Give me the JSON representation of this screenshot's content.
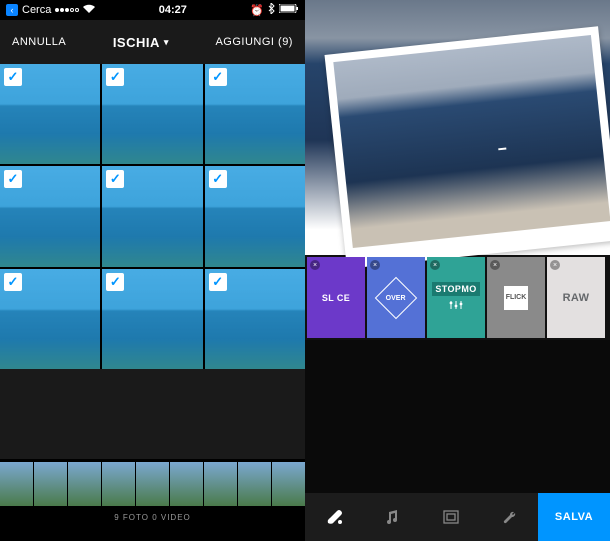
{
  "left": {
    "status": {
      "back_label": "Cerca",
      "time": "04:27",
      "signal_filled": 3,
      "signal_total": 5
    },
    "nav": {
      "cancel": "ANNULLA",
      "title": "ISCHIA",
      "add": "AGGIUNGI (9)"
    },
    "grid_selected_count": 9,
    "footer": "9 FOTO   0 VIDEO",
    "strip_thumbs_count": 9
  },
  "right": {
    "filters": [
      {
        "id": "slice",
        "label": "SL CE",
        "text_color": "#ffffff"
      },
      {
        "id": "over",
        "label": "OVER",
        "text_color": "#ffffff"
      },
      {
        "id": "stopmo",
        "label": "STOPMO",
        "text_color": "#ffffff"
      },
      {
        "id": "flick",
        "label": "FLICK",
        "text_color": "#555555"
      },
      {
        "id": "raw",
        "label": "RAW",
        "text_color": "#65686b"
      }
    ],
    "bottom_icons": [
      "paint",
      "music",
      "frame",
      "wrench"
    ],
    "save_label": "SALVA"
  }
}
